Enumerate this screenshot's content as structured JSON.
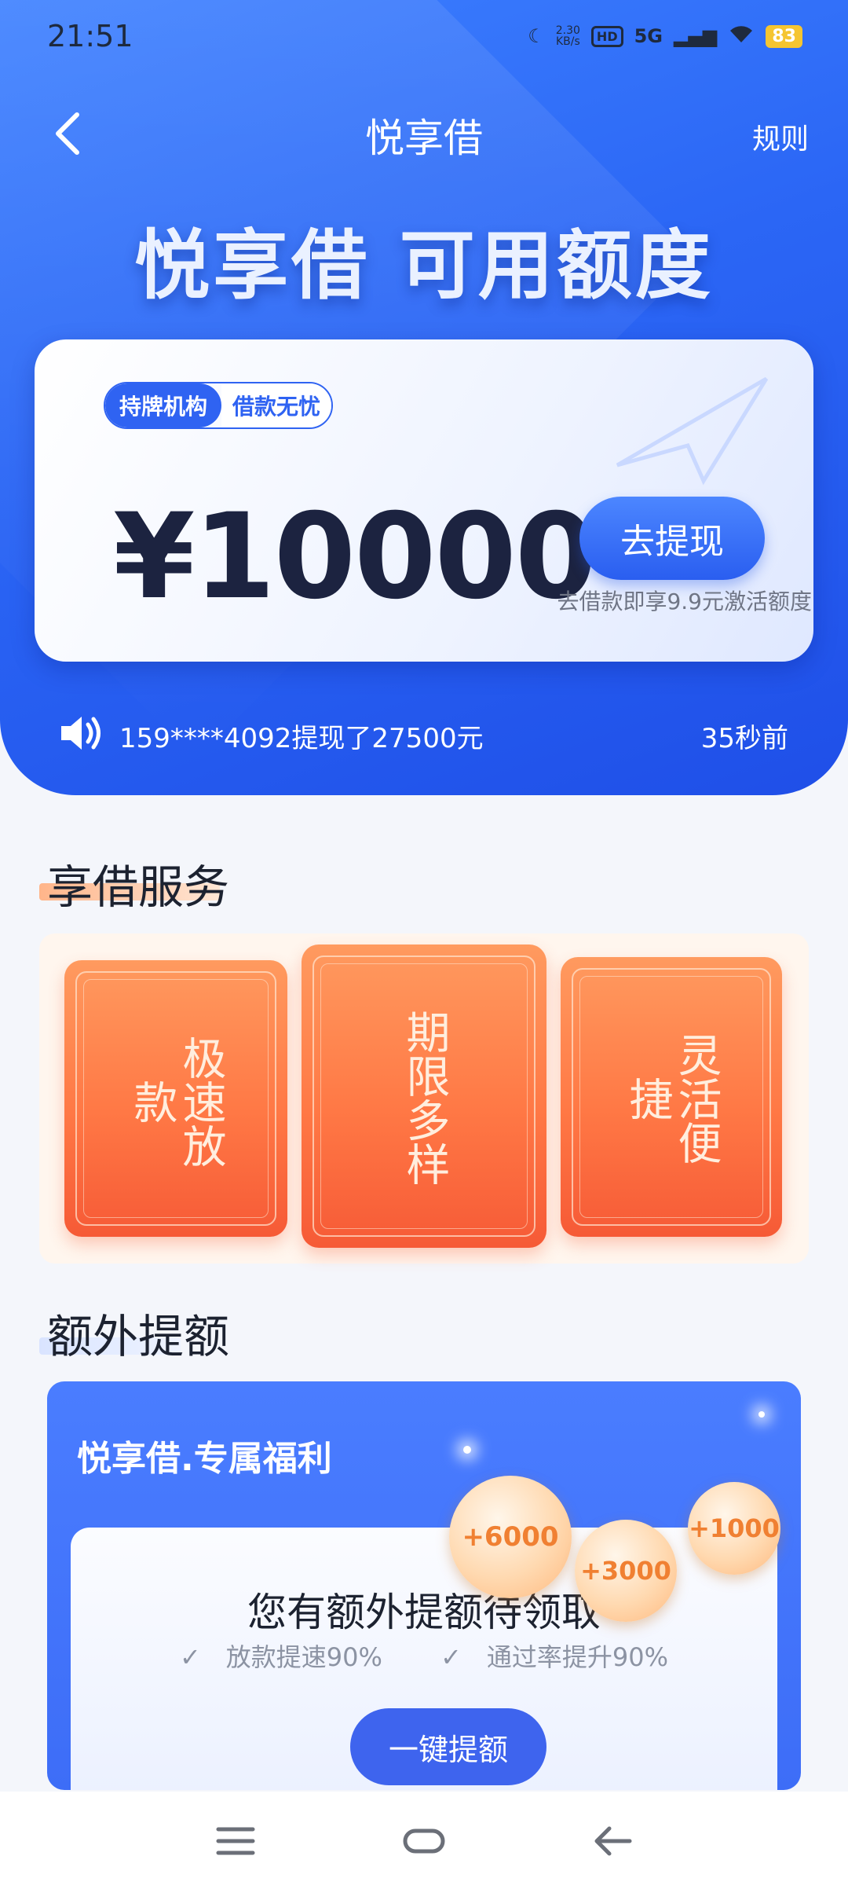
{
  "status_bar": {
    "time": "21:51",
    "speed_value": "2.30",
    "speed_unit": "KB/s",
    "hd": "HD",
    "network": "5G",
    "battery": "83"
  },
  "nav": {
    "title": "悦享借",
    "rules": "规则"
  },
  "hero": {
    "headline": "悦享借 可用额度"
  },
  "card": {
    "badge_primary": "持牌机构",
    "badge_secondary": "借款无忧",
    "amount": "¥10000",
    "withdraw_label": "去提现",
    "promo_text": "去借款即享9.9元激活额度"
  },
  "ticker": {
    "message": "159****4092提现了27500元",
    "time_ago": "35秒前"
  },
  "services": {
    "title": "享借服务",
    "items": [
      {
        "label": "极速放款"
      },
      {
        "label": "期限多样"
      },
      {
        "label": "灵活便捷"
      }
    ]
  },
  "extra": {
    "section_title": "额外提额",
    "banner_title": "悦享借.专属福利",
    "heading": "您有额外提额待领取",
    "check_1": "放款提速90%",
    "check_2": "通过率提升90%",
    "button": "一键提额",
    "bubbles": [
      "+6000",
      "+3000",
      "+1000"
    ]
  },
  "colors": {
    "primary_blue": "#2b66f5",
    "accent_orange": "#ff7845"
  }
}
